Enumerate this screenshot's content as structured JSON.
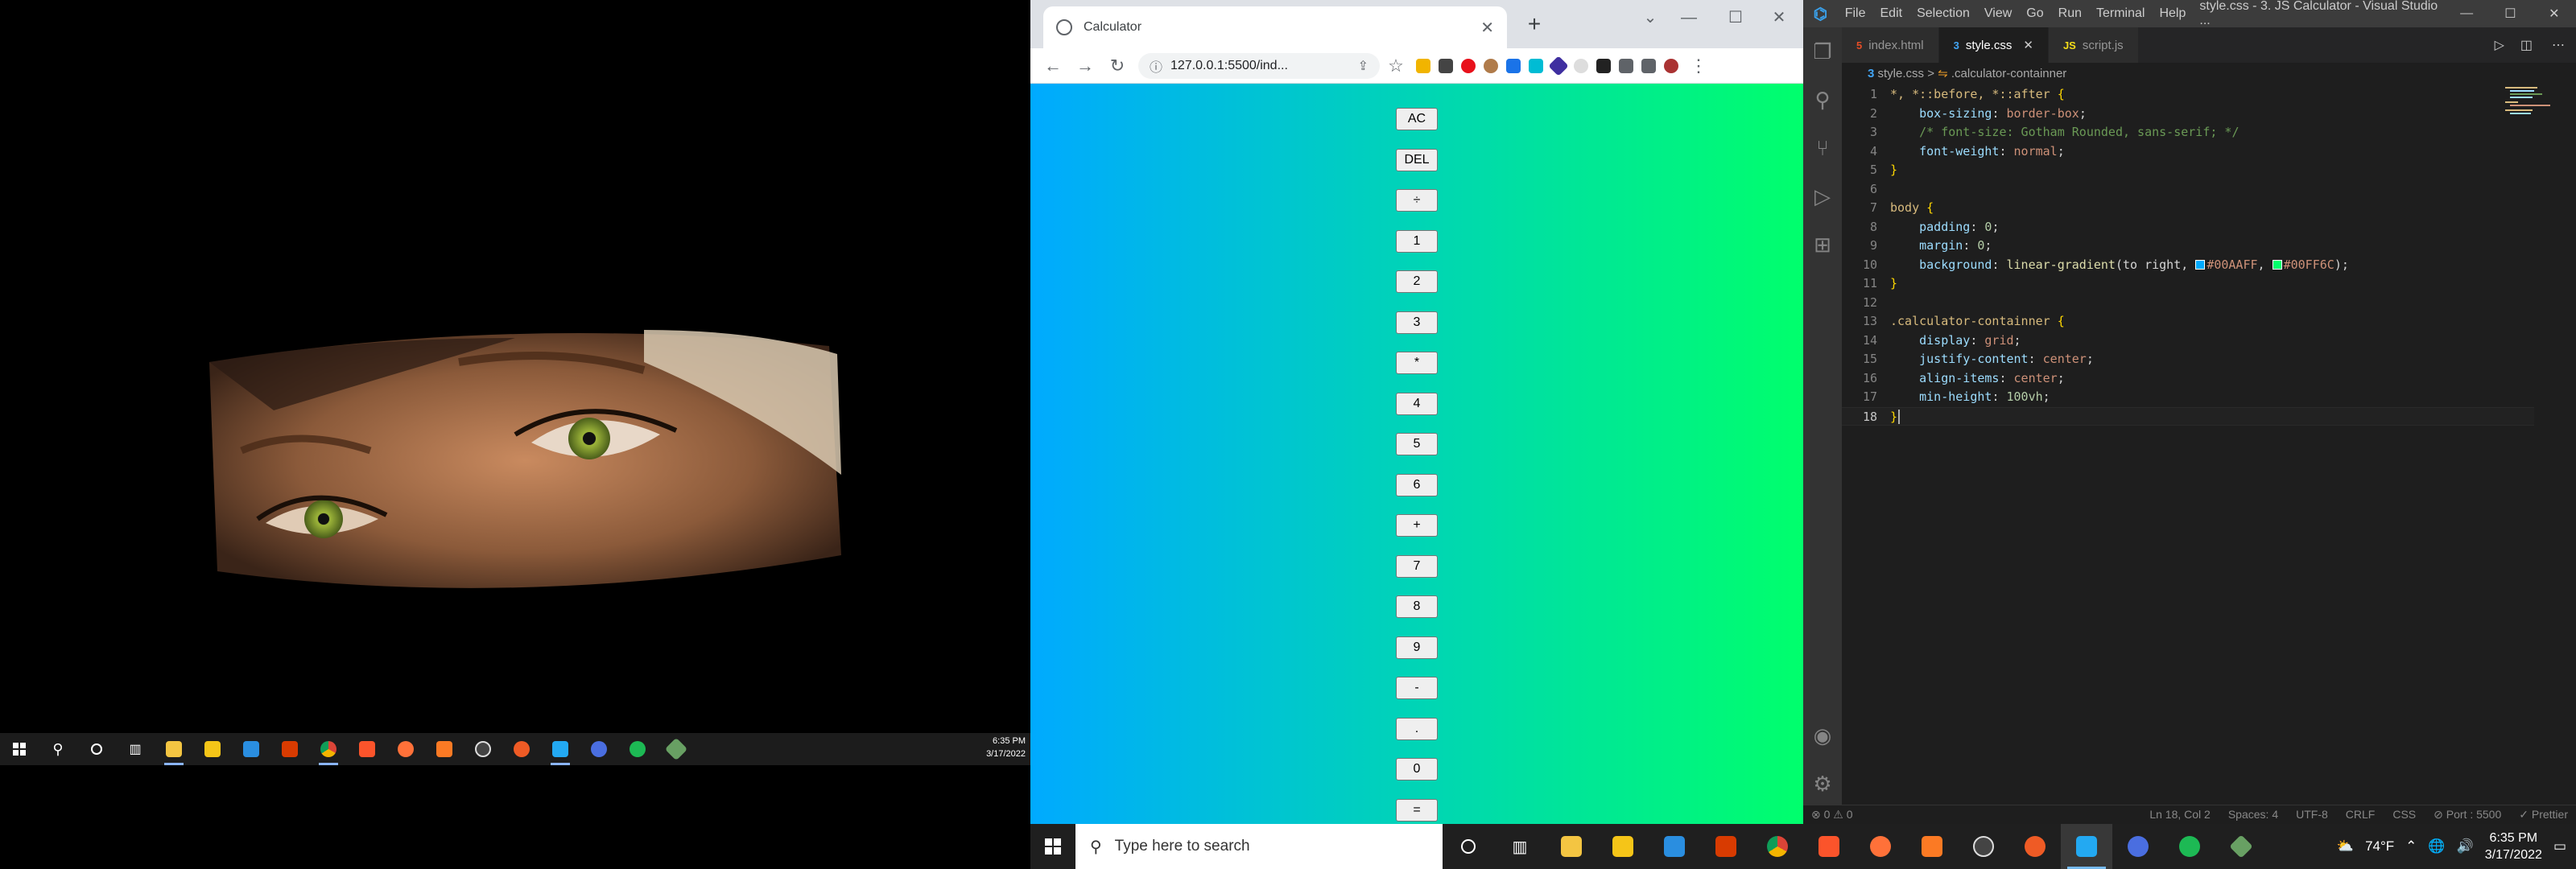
{
  "left_taskbar": {
    "clock_time": "6:35 PM",
    "clock_date": "3/17/2022"
  },
  "chrome": {
    "tab_title": "Calculator",
    "close_tab": "✕",
    "new_tab": "+",
    "url": "127.0.0.1:5500/ind...",
    "back": "←",
    "forward": "→",
    "reload": "↻"
  },
  "calculator": {
    "buttons": [
      "AC",
      "DEL",
      "÷",
      "1",
      "2",
      "3",
      "*",
      "4",
      "5",
      "6",
      "+",
      "7",
      "8",
      "9",
      "-",
      ".",
      "0",
      "="
    ]
  },
  "vscode": {
    "menu": [
      "File",
      "Edit",
      "Selection",
      "View",
      "Go",
      "Run",
      "Terminal",
      "Help"
    ],
    "window_title": "style.css - 3. JS Calculator - Visual Studio ...",
    "tabs": [
      {
        "label": "index.html",
        "icon": "html-file-icon",
        "active": false
      },
      {
        "label": "style.css",
        "icon": "css-file-icon",
        "active": true
      },
      {
        "label": "script.js",
        "icon": "js-file-icon",
        "active": false
      }
    ],
    "breadcrumb_file": "style.css",
    "breadcrumb_sep": ">",
    "breadcrumb_symbol": ".calculator-containner",
    "code": {
      "l1_sel": "*, *::before, *::after",
      "l2_prop": "box-sizing",
      "l2_val": "border-box",
      "l3_comment": "/* font-size: Gotham Rounded, sans-serif; */",
      "l4_prop": "font-weight",
      "l4_val": "normal",
      "l7_sel": "body",
      "l8_prop": "padding",
      "l8_val": "0",
      "l9_prop": "margin",
      "l9_val": "0",
      "l10_prop": "background",
      "l10_fn": "linear-gradient",
      "l10_arg": "to right, ",
      "l10_c1": "#00AAFF",
      "l10_c2": "#00FF6C",
      "l13_sel": ".calculator-containner",
      "l14_prop": "display",
      "l14_val": "grid",
      "l15_prop": "justify-content",
      "l15_val": "center",
      "l16_prop": "align-items",
      "l16_val": "center",
      "l17_prop": "min-height",
      "l17_val": "100vh"
    },
    "status": {
      "problems": "⊗ 0 ⚠ 0",
      "position": "Ln 18, Col 2",
      "spaces": "Spaces: 4",
      "encoding": "UTF-8",
      "eol": "CRLF",
      "language": "CSS",
      "port": "⊘ Port : 5500",
      "prettier": "✓ Prettier"
    }
  },
  "taskbar": {
    "search_placeholder": "Type here to search",
    "weather": "74°F",
    "time": "6:35 PM",
    "date": "3/17/2022"
  },
  "colors": {
    "gradient_start": "#00AAFF",
    "gradient_end": "#00FF6C",
    "vscode_bg": "#1e1e1e"
  }
}
